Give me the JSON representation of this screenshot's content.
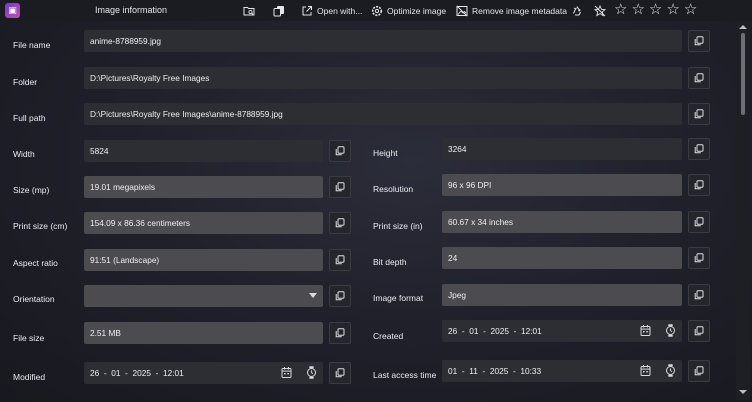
{
  "window": {
    "title": "Image information"
  },
  "toolbar": {
    "open_with": "Open with...",
    "optimize": "Optimize image",
    "remove_metadata": "Remove image metadata"
  },
  "stars": [
    "☆",
    "☆",
    "☆",
    "☆",
    "☆"
  ],
  "fields": {
    "file_name": {
      "label": "File name",
      "value": "anime-8788959.jpg"
    },
    "folder": {
      "label": "Folder",
      "value": "D:\\Pictures\\Royalty Free Images"
    },
    "full_path": {
      "label": "Full path",
      "value": "D:\\Pictures\\Royalty Free Images\\anime-8788959.jpg"
    },
    "width": {
      "label": "Width",
      "value": "5824"
    },
    "height": {
      "label": "Height",
      "value": "3264"
    },
    "size_mp": {
      "label": "Size (mp)",
      "value": "19.01 megapixels"
    },
    "resolution": {
      "label": "Resolution",
      "value": "96 x 96 DPI"
    },
    "print_cm": {
      "label": "Print size (cm)",
      "value": "154.09 x 86.36 centimeters"
    },
    "print_in": {
      "label": "Print size (in)",
      "value": "60.67 x 34 inches"
    },
    "aspect": {
      "label": "Aspect ratio",
      "value": "91:51 (Landscape)"
    },
    "bit_depth": {
      "label": "Bit depth",
      "value": "24"
    },
    "orientation": {
      "label": "Orientation",
      "value": ""
    },
    "format": {
      "label": "Image format",
      "value": "Jpeg"
    },
    "file_size": {
      "label": "File size",
      "value": "2.51 MB"
    },
    "created": {
      "label": "Created",
      "day": "26",
      "month": "01",
      "year": "2025",
      "time": "12:01"
    },
    "modified": {
      "label": "Modified",
      "day": "26",
      "month": "01",
      "year": "2025",
      "time": "12:01"
    },
    "last_access": {
      "label": "Last access time",
      "day": "01",
      "month": "11",
      "year": "2025",
      "time": "10:33"
    }
  },
  "date_sep": "-"
}
